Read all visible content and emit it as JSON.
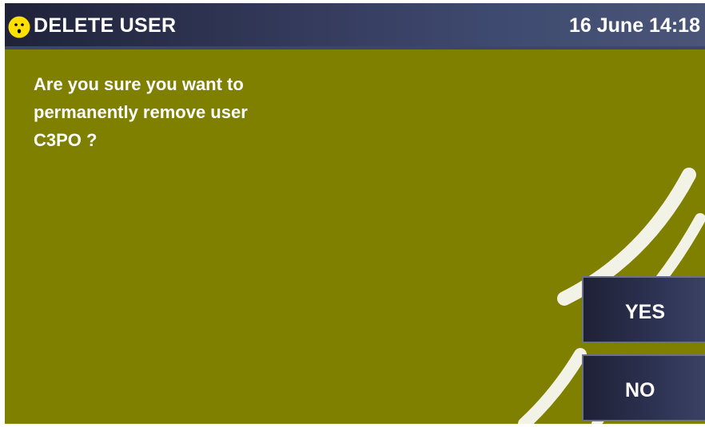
{
  "header": {
    "icon": "smiley-face-icon",
    "title": "DELETE USER",
    "datetime": "16 June 14:18"
  },
  "dialog": {
    "message_lines": [
      "Are you sure you want to",
      "permanently remove user",
      "C3PO ?"
    ]
  },
  "buttons": {
    "yes_label": "YES",
    "no_label": "NO"
  },
  "colors": {
    "background": "#7f7f00",
    "header": "#33395a",
    "text": "#ffffff",
    "icon": "#ffe000"
  }
}
